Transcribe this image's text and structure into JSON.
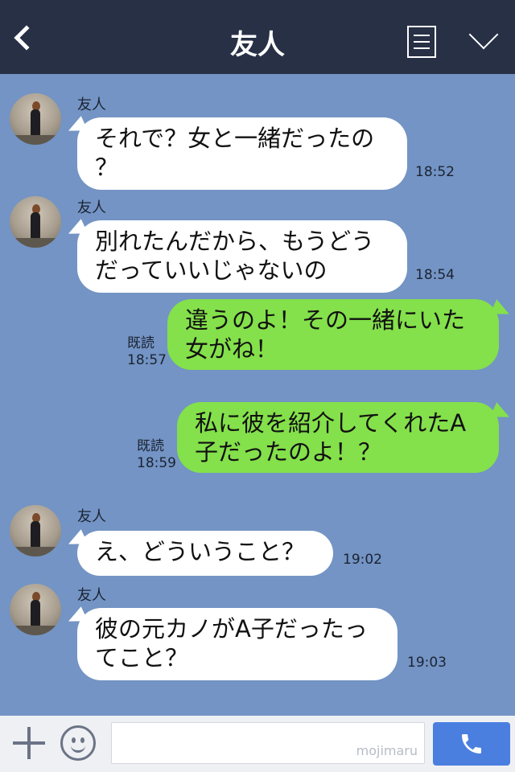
{
  "header": {
    "title": "友人"
  },
  "messages": [
    {
      "sender": "友人",
      "text": "それで？女と一緒だったの\n？",
      "time": "18:52"
    },
    {
      "sender": "友人",
      "text": "別れたんだから、もうどう\nだっていいじゃないの",
      "time": "18:54"
    },
    {
      "text": "違うのよ！その一緒にいた\n女がね！",
      "read": "既読",
      "time": "18:57"
    },
    {
      "text": "私に彼を紹介してくれたA\n子だったのよ！？",
      "read": "既読",
      "time": "18:59"
    },
    {
      "sender": "友人",
      "text": "え、どういうこと？",
      "time": "19:02"
    },
    {
      "sender": "友人",
      "text": "彼の元カノがA子だったっ\nてこと？",
      "time": "19:03"
    }
  ],
  "footer": {
    "watermark": "mojimaru"
  },
  "colors": {
    "header_bg": "#283046",
    "chat_bg": "#7394c4",
    "outgoing_bubble": "#84e04b",
    "incoming_bubble": "#ffffff",
    "call_button": "#4a7fe0"
  },
  "icons": {
    "back": "chevron-left-icon",
    "notes": "notes-icon",
    "menu": "chevron-down-icon",
    "add": "plus-icon",
    "emoji": "smiley-icon",
    "call": "phone-icon"
  }
}
